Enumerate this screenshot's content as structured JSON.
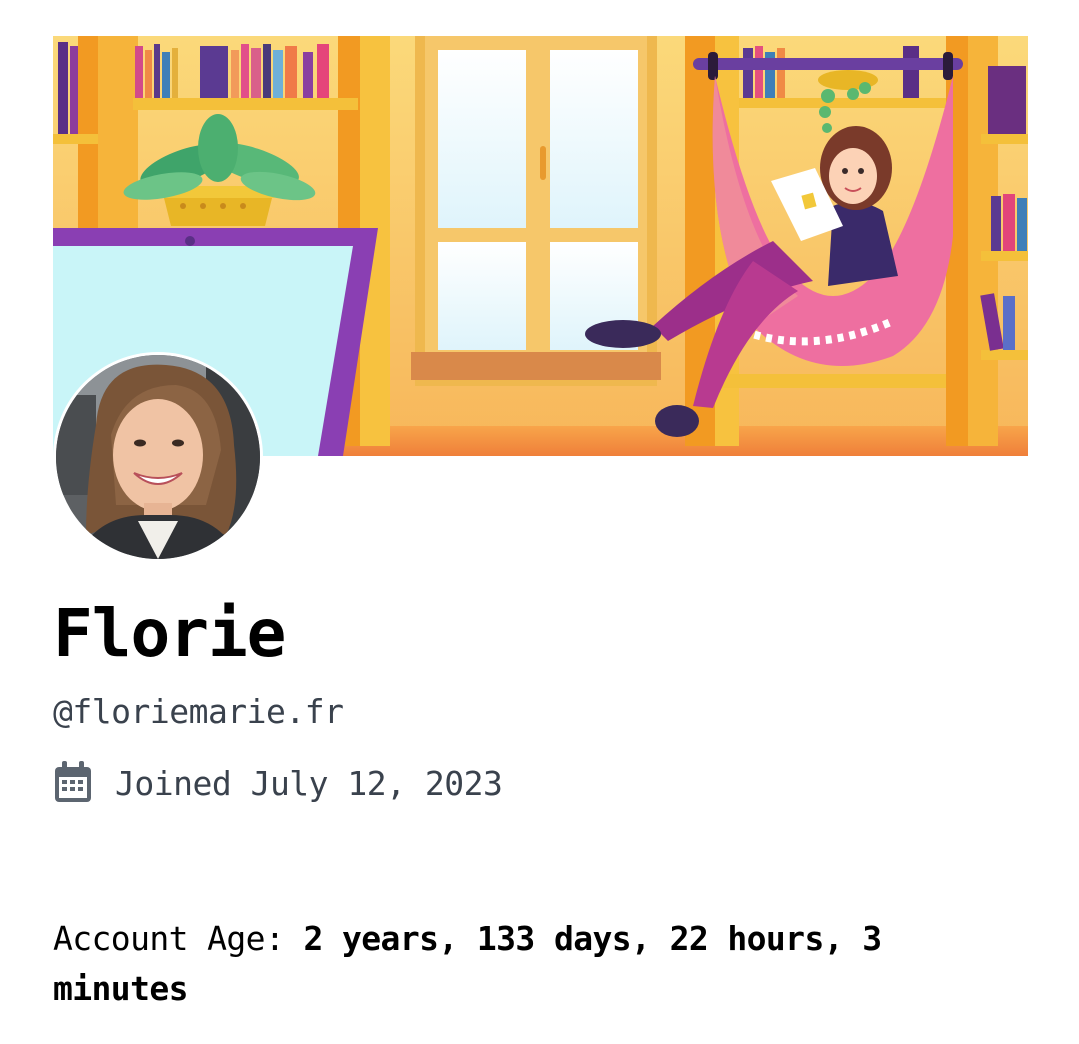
{
  "profile": {
    "display_name": "Florie",
    "handle": "@floriemarie.fr",
    "joined": "Joined July 12, 2023",
    "account_age_label": "Account Age: ",
    "account_age_value": "2 years, 133 days, 22 hours, 3 minutes"
  },
  "icons": {
    "joined": "calendar-icon"
  },
  "colors": {
    "text_primary": "#000000",
    "text_secondary": "#3a424d",
    "banner_accent": "#f4a521",
    "hammock": "#ee6fa0"
  }
}
